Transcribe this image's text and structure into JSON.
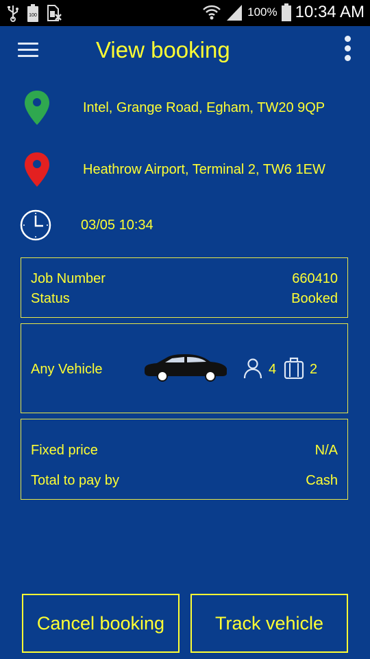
{
  "status_bar": {
    "battery_percent": "100%",
    "time": "10:34 AM",
    "left_icons": [
      "usb-icon",
      "battery-100-icon",
      "sim-blocked-icon"
    ],
    "right_icons": [
      "wifi-icon",
      "signal-icon",
      "battery-icon"
    ]
  },
  "app_bar": {
    "title": "View booking",
    "menu_icon": "hamburger-menu-icon",
    "overflow_icon": "more-vert-icon"
  },
  "booking": {
    "pickup": "Intel, Grange Road, Egham, TW20 9QP",
    "dropoff": "Heathrow Airport, Terminal 2, TW6 1EW",
    "datetime": "03/05 10:34"
  },
  "job": {
    "number_label": "Job Number",
    "number_value": "660410",
    "status_label": "Status",
    "status_value": "Booked"
  },
  "vehicle": {
    "type": "Any Vehicle",
    "passengers": "4",
    "luggage": "2"
  },
  "payment": {
    "price_label": "Fixed price",
    "price_value": "N/A",
    "pay_label": "Total to pay by",
    "pay_value": "Cash"
  },
  "actions": {
    "cancel": "Cancel booking",
    "track": "Track vehicle"
  },
  "colors": {
    "background": "#0a3d8c",
    "accent_text": "#ffff33",
    "pickup_pin": "#2fa84f",
    "dropoff_pin": "#e32020"
  }
}
